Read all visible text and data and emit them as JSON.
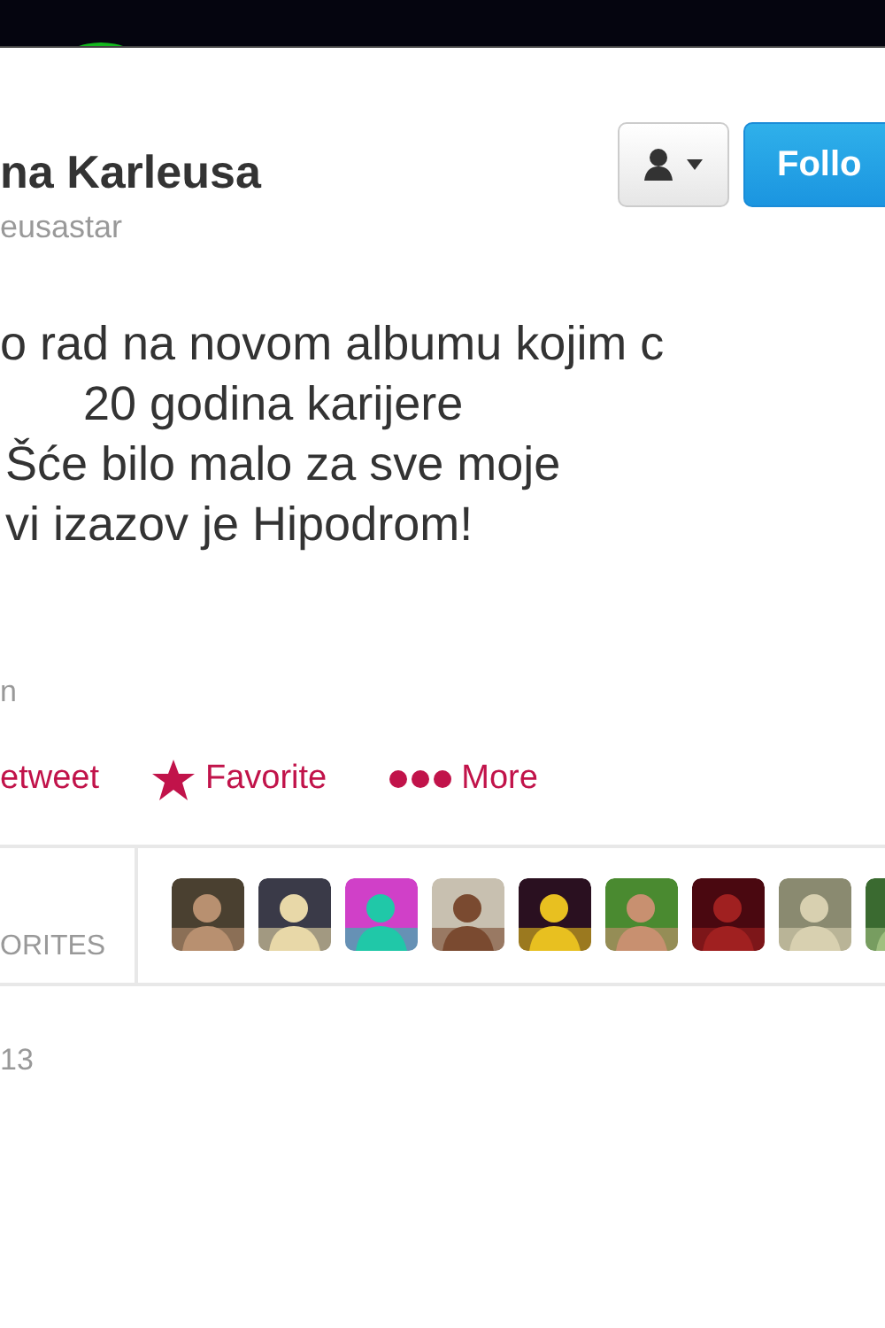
{
  "profile": {
    "name": "na Karleusa",
    "handle": "eusastar"
  },
  "buttons": [
    {
      "kind": "user-menu"
    },
    {
      "kind": "follow",
      "label": "Follo"
    }
  ],
  "tweet": {
    "lines": [
      "o rad na novom albumu kojim c",
      "20 godina karijere",
      "Šće bilo malo za sve moje",
      "vi izazov je Hipodrom!"
    ]
  },
  "expand_text": "n",
  "actions": [
    {
      "kind": "retweet",
      "label": "etweet"
    },
    {
      "kind": "favorite",
      "label": "Favorite"
    },
    {
      "kind": "more",
      "label": "More"
    }
  ],
  "stats": {
    "label": "ORITES"
  },
  "timestamp": "13"
}
